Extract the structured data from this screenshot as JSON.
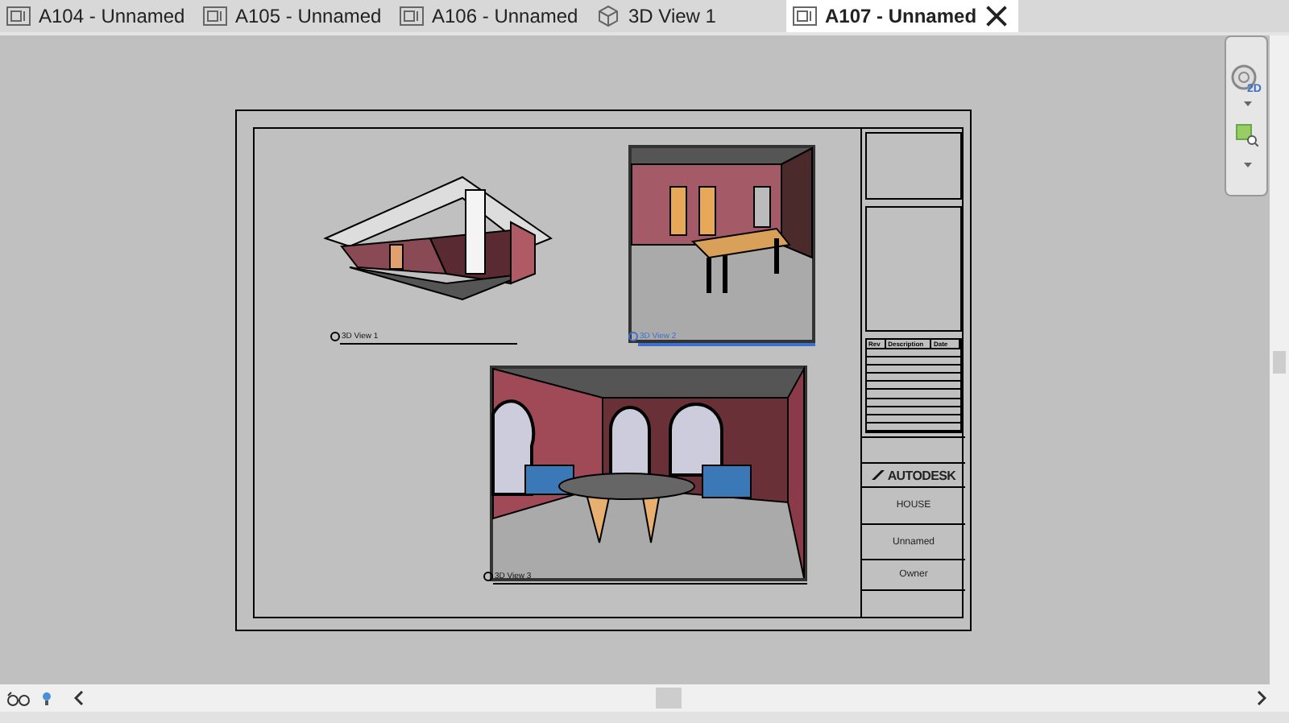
{
  "tabs": [
    {
      "label": "A104 - Unnamed",
      "kind": "sheet",
      "selected": false
    },
    {
      "label": "A105 - Unnamed",
      "kind": "sheet",
      "selected": false
    },
    {
      "label": "A106 - Unnamed",
      "kind": "sheet",
      "selected": false
    },
    {
      "label": "3D View 1",
      "kind": "model",
      "selected": false
    },
    {
      "label": "A107 - Unnamed",
      "kind": "sheet",
      "selected": true
    }
  ],
  "navigation_bar": {
    "mode_label": "2D"
  },
  "sheet": {
    "views": [
      {
        "label": "3D View 1",
        "kind": "exterior",
        "selected": false
      },
      {
        "label": "3D View 2",
        "kind": "dining",
        "selected": true
      },
      {
        "label": "3D View 3",
        "kind": "living",
        "selected": false
      }
    ],
    "title_block": {
      "revision_columns": [
        "Rev",
        "Description",
        "Date"
      ],
      "logo": "AUTODESK",
      "project": "HOUSE",
      "sheet_name": "Unnamed",
      "client": "Owner"
    }
  }
}
